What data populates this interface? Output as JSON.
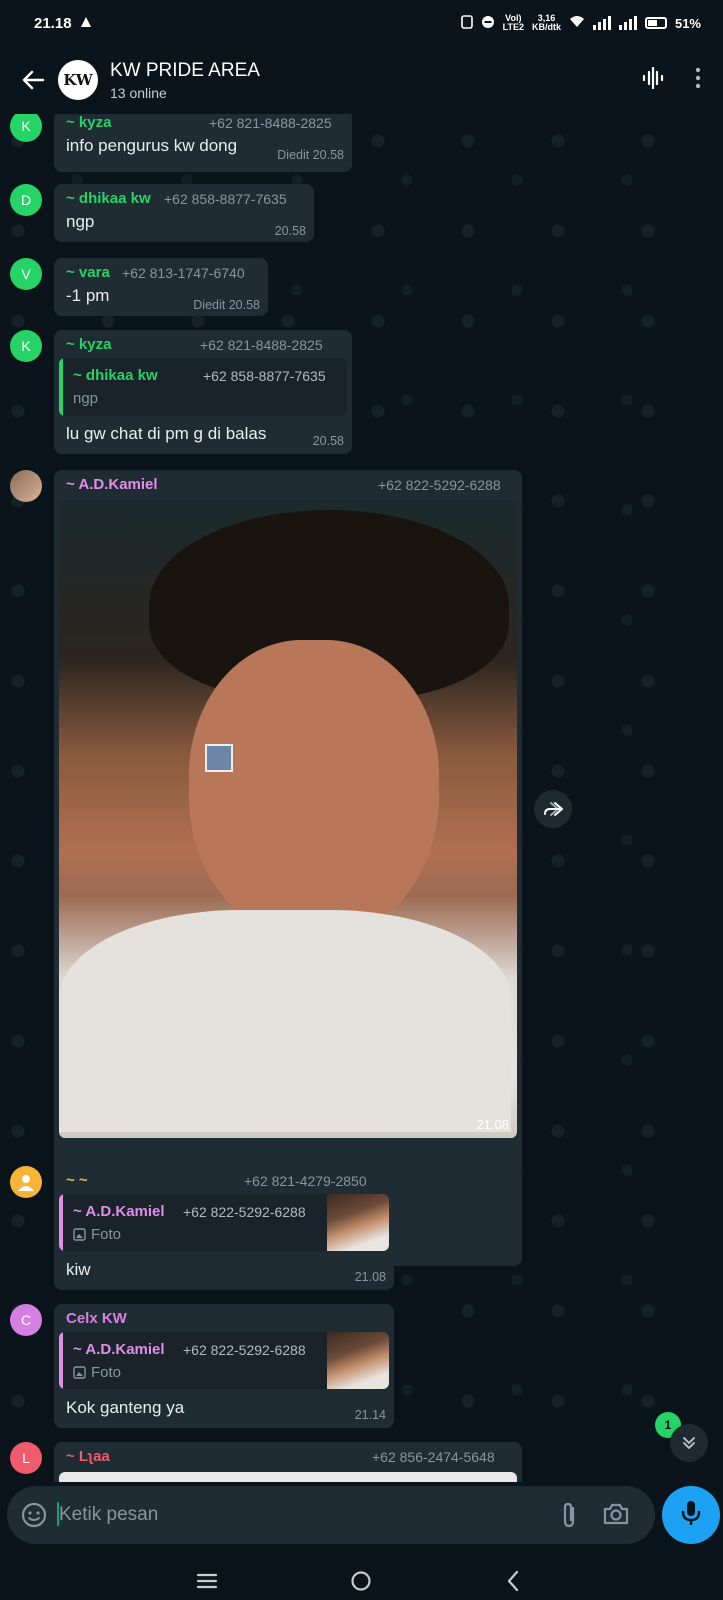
{
  "status_bar": {
    "time": "21.18",
    "network_top": "3,16",
    "network_bottom": "KB/dtk",
    "lte_top": "Vol)",
    "lte_bottom": "LTE2",
    "battery": "51%"
  },
  "header": {
    "title": "KW PRIDE AREA",
    "subtitle": "13 online",
    "avatar_text": "KW"
  },
  "messages": [
    {
      "avatar": "K",
      "avatar_color": "#25d366",
      "sender": "~ kyza",
      "sender_color": "#25d366",
      "phone": "+62 821-8488-2825",
      "text": "info pengurus kw dong",
      "meta": "Diedit 20.58"
    },
    {
      "avatar": "D",
      "avatar_color": "#25d366",
      "sender": "~ dhikaa kw",
      "sender_color": "#25d366",
      "phone": "+62 858-8877-7635",
      "text": "ngp",
      "meta": "20.58"
    },
    {
      "avatar": "V",
      "avatar_color": "#25d366",
      "sender": "~ vara",
      "sender_color": "#25d366",
      "phone": "+62 813-1747-6740",
      "text": "-1 pm",
      "meta": "Diedit 20.58"
    },
    {
      "avatar": "K",
      "avatar_color": "#25d366",
      "sender": "~ kyza",
      "sender_color": "#25d366",
      "phone": "+62 821-8488-2825",
      "quote_name": "~ dhikaa kw",
      "quote_phone": "+62 858-8877-7635",
      "quote_text": "ngp",
      "text": "lu gw chat di pm g di balas",
      "meta": "20.58"
    },
    {
      "sender": "~ A.D.Kamiel",
      "sender_color": "#e08fe8",
      "phone": "+62 822-5292-6288",
      "meta": "21.08"
    },
    {
      "avatar": "",
      "sender": "~ ~",
      "sender_color": "#f5b638",
      "phone": "+62 821-4279-2850",
      "quote_name": "~ A.D.Kamiel",
      "quote_phone": "+62 822-5292-6288",
      "quote_text": "Foto",
      "text": "kiw",
      "meta": "21.08"
    },
    {
      "avatar": "C",
      "avatar_color": "#d580e0",
      "sender": "Celx KW",
      "sender_color": "#d580e0",
      "phone": "",
      "quote_name": "~ A.D.Kamiel",
      "quote_phone": "+62 822-5292-6288",
      "quote_text": "Foto",
      "text": "Kok ganteng ya",
      "meta": "21.14"
    },
    {
      "avatar": "L",
      "avatar_color": "#f15c6d",
      "sender": "~ Lʅaa",
      "sender_color": "#f15c6d",
      "phone": "+62 856-2474-5648"
    }
  ],
  "unread_count": "1",
  "composer": {
    "placeholder": "Ketik pesan"
  }
}
